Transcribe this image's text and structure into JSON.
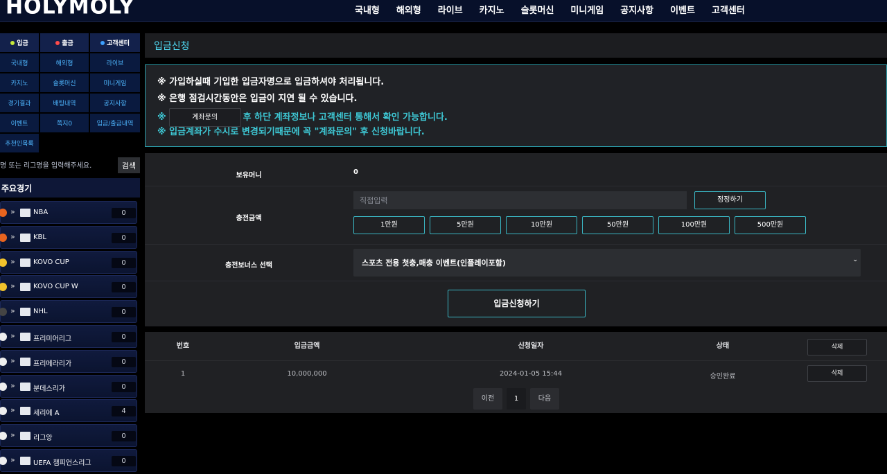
{
  "site": {
    "logo": "HOLYMOLY"
  },
  "top_nav": [
    "국내형",
    "해외형",
    "라이브",
    "카지노",
    "슬롯머신",
    "미니게임",
    "공지사항",
    "이벤트",
    "고객센터"
  ],
  "sidebar": {
    "menu_top": [
      {
        "label": "입금",
        "dot_color": "#c6e83a"
      },
      {
        "label": "출금",
        "dot_color": "#ff4b4b"
      },
      {
        "label": "고객센터",
        "dot_color": "#3da0ff"
      }
    ],
    "menu": [
      "국내형",
      "해외형",
      "라이브",
      "카지노",
      "슬롯머신",
      "미니게임",
      "경기결과",
      "배팅내역",
      "공지사항",
      "이벤트",
      "쪽지0",
      "입금/출금내역",
      "추천인목록"
    ],
    "search_placeholder": "명 또는 리그명을 입력해주세요.",
    "search_button": "검색",
    "featured_title": "주요경기",
    "leagues": [
      {
        "name": "NBA",
        "count": "0",
        "ball_color": "#e8641f"
      },
      {
        "name": "KBL",
        "count": "0",
        "ball_color": "#e8641f"
      },
      {
        "name": "KOVO CUP",
        "count": "0",
        "ball_color": "#f1c22c"
      },
      {
        "name": "KOVO CUP W",
        "count": "0",
        "ball_color": "#f1c22c"
      },
      {
        "name": "NHL",
        "count": "0",
        "ball_color": "#444444"
      },
      {
        "name": "프리미어리그",
        "count": "0",
        "ball_color": "#eeeeee"
      },
      {
        "name": "프리메라리가",
        "count": "0",
        "ball_color": "#eeeeee"
      },
      {
        "name": "분데스리가",
        "count": "0",
        "ball_color": "#eeeeee"
      },
      {
        "name": "세리에 A",
        "count": "4",
        "ball_color": "#eeeeee"
      },
      {
        "name": "리그앙",
        "count": "0",
        "ball_color": "#eeeeee"
      },
      {
        "name": "UEFA 챔피언스리그",
        "count": "0",
        "ball_color": "#eeeeee"
      }
    ]
  },
  "page": {
    "title": "입금신청"
  },
  "notice": {
    "line1": "※ 가입하실때 기입한 입금자명으로 입금하셔야 처리됩니다.",
    "line2": "※ 은행 점검시간동안은 입금이 지연 될 수 있습니다.",
    "line3_prefix": "※",
    "inquiry_button": "계좌문의",
    "line3_suffix": "후 하단 계좌정보나 고객센터 통해서 확인 가능합니다.",
    "line4": "※ 입금계좌가 수시로 변경되기때문에 꼭 \"계좌문의\" 후 신청바랍니다."
  },
  "form": {
    "balance_label": "보유머니",
    "balance_value": "0",
    "amount_label": "충전금액",
    "amount_placeholder": "직접입력",
    "reset_button": "정정하기",
    "quick_amounts": [
      "1만원",
      "5만원",
      "10만원",
      "50만원",
      "100만원",
      "500만원"
    ],
    "bonus_label": "충전보너스 선택",
    "bonus_selected": "스포츠 전용 첫충,매충 이벤트(인플레이포함)",
    "submit_button": "입금신청하기"
  },
  "history": {
    "headers": [
      "번호",
      "입금금액",
      "신청일자",
      "상태"
    ],
    "header_delete": "삭제",
    "rows": [
      {
        "no": "1",
        "amount": "10,000,000",
        "date": "2024-01-05 15:44",
        "status": "승인완료",
        "delete": "삭제"
      }
    ],
    "pager": {
      "prev": "이전",
      "page": "1",
      "next": "다음"
    }
  }
}
